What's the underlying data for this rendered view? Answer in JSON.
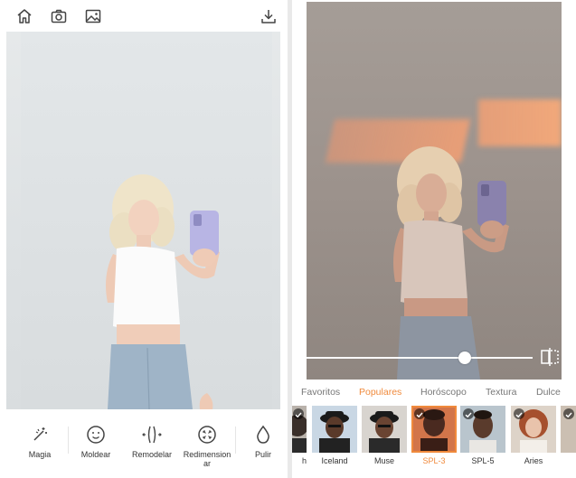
{
  "left_panel": {
    "toolbar": {
      "icons": [
        "home-icon",
        "camera-icon",
        "gallery-icon",
        "download-icon"
      ]
    },
    "tools": [
      {
        "label": "Magia",
        "icon": "magic-wand-icon"
      },
      {
        "label": "Moldear",
        "icon": "face-smile-icon"
      },
      {
        "label": "Remodelar",
        "icon": "reshape-icon"
      },
      {
        "label": "Redimension ar",
        "label_line1": "Redimension",
        "label_line2": "ar",
        "icon": "resize-icon"
      },
      {
        "label": "Pulir",
        "icon": "drop-icon"
      }
    ]
  },
  "right_panel": {
    "filter_intensity": 0.7,
    "tabs": [
      {
        "label": "Favoritos",
        "active": false
      },
      {
        "label": "Populares",
        "active": true
      },
      {
        "label": "Horóscopo",
        "active": false
      },
      {
        "label": "Textura",
        "active": false
      },
      {
        "label": "Dulce",
        "active": false
      }
    ],
    "filters": [
      {
        "label": "h",
        "checked": true,
        "selected": false
      },
      {
        "label": "Iceland",
        "checked": false,
        "selected": false
      },
      {
        "label": "Muse",
        "checked": false,
        "selected": false
      },
      {
        "label": "SPL-3",
        "checked": true,
        "selected": true
      },
      {
        "label": "SPL-5",
        "checked": true,
        "selected": false
      },
      {
        "label": "Aries",
        "checked": true,
        "selected": false
      }
    ]
  },
  "colors": {
    "accent": "#f08a3c",
    "icon": "#444444",
    "text": "#333333",
    "tab_inactive": "#777777"
  }
}
